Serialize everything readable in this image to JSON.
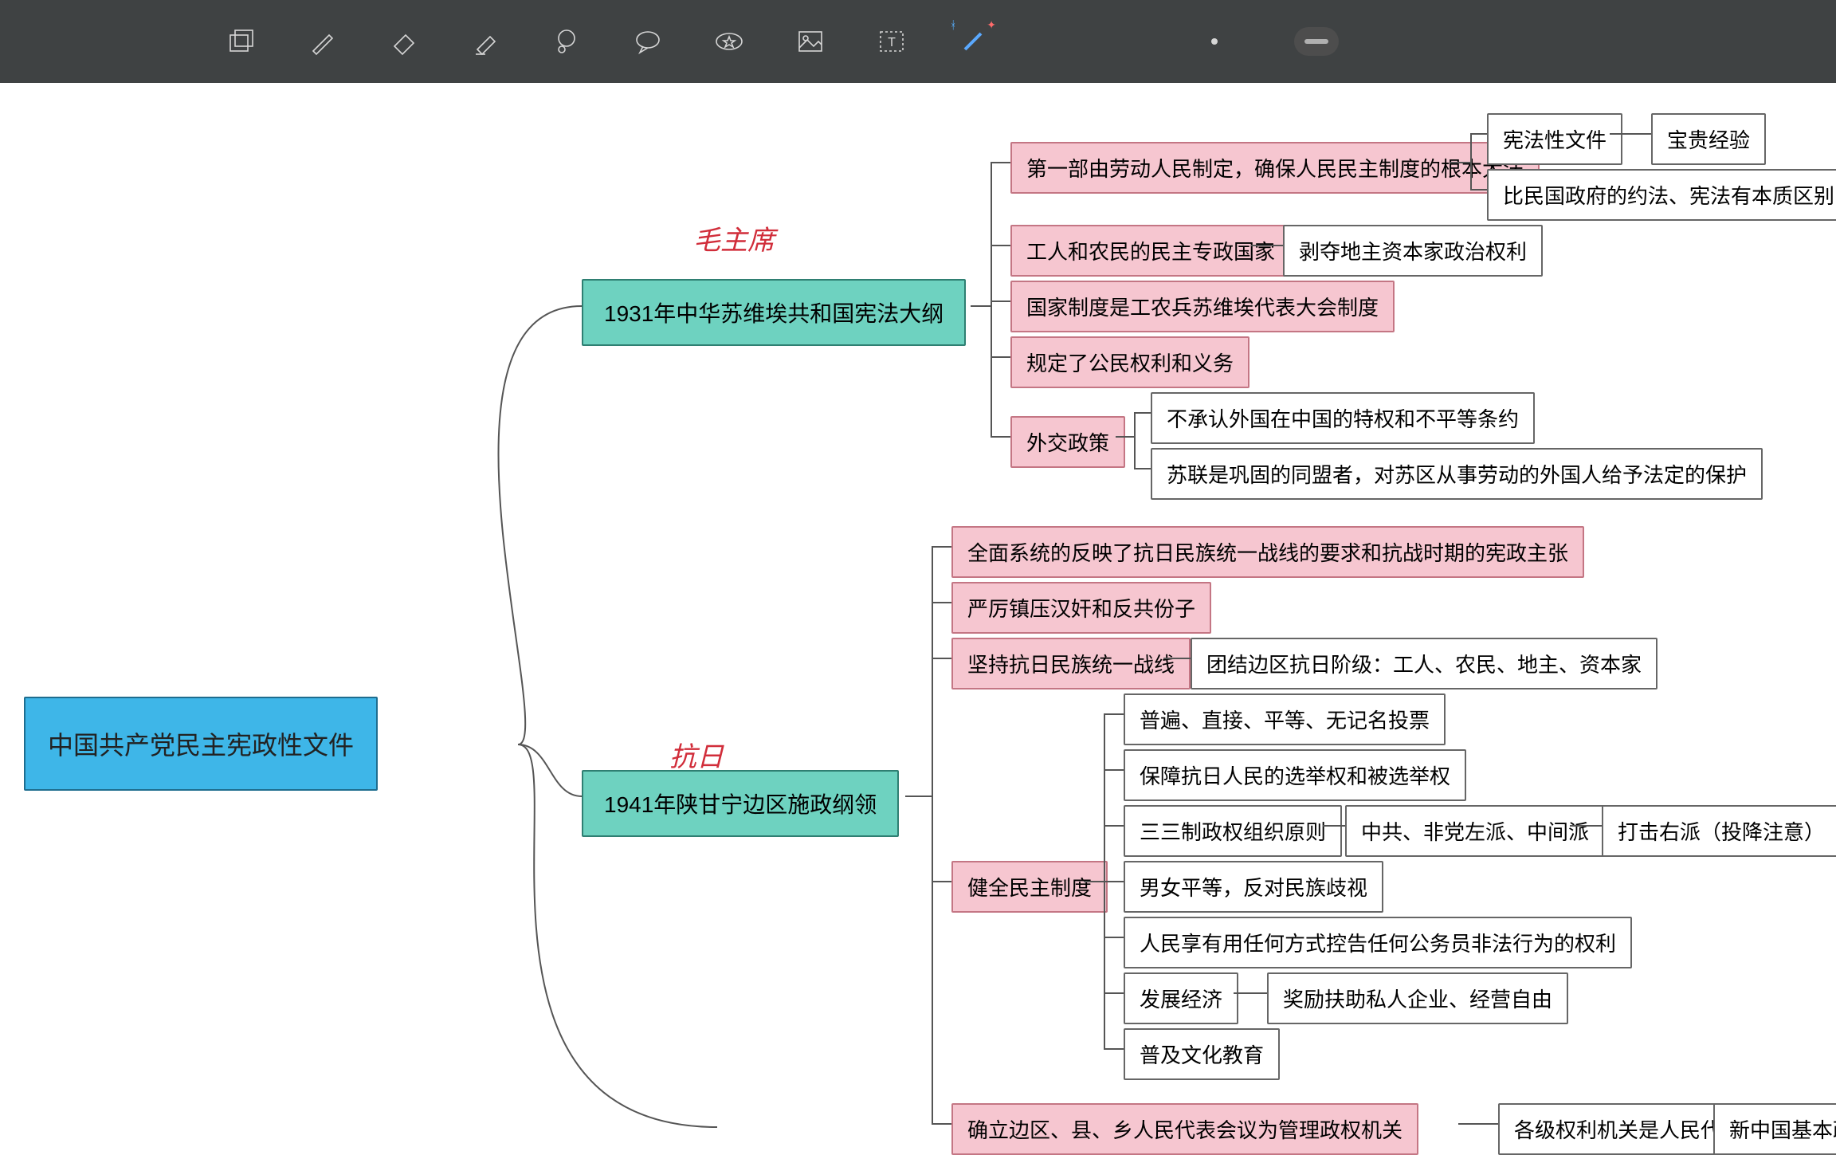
{
  "toolbar": {
    "icons": [
      "layers",
      "pen",
      "eraser",
      "highlighter",
      "lasso-circle",
      "speech-bubble",
      "star-badge",
      "image",
      "text",
      "magic-wand"
    ]
  },
  "annotations": {
    "hand1": "毛主席",
    "hand2": "抗日"
  },
  "mindmap": {
    "root": "中国共产党民主宪政性文件",
    "branch1": {
      "title": "1931年中华苏维埃共和国宪法大纲",
      "children": {
        "c1": "第一部由劳动人民制定，确保人民民主制度的根本大法",
        "c1a": "宪法性文件",
        "c1b": "宝贵经验",
        "c1c": "比民国政府的约法、宪法有本质区别",
        "c2": "工人和农民的民主专政国家",
        "c2a": "剥夺地主资本家政治权利",
        "c3": "国家制度是工农兵苏维埃代表大会制度",
        "c4": "规定了公民权利和义务",
        "c5": "外交政策",
        "c5a": "不承认外国在中国的特权和不平等条约",
        "c5b": "苏联是巩固的同盟者，对苏区从事劳动的外国人给予法定的保护"
      }
    },
    "branch2": {
      "title": "1941年陕甘宁边区施政纲领",
      "children": {
        "d1": "全面系统的反映了抗日民族统一战线的要求和抗战时期的宪政主张",
        "d2": "严厉镇压汉奸和反共份子",
        "d3": "坚持抗日民族统一战线",
        "d3a": "团结边区抗日阶级：工人、农民、地主、资本家",
        "d4": "健全民主制度",
        "d4a": "普遍、直接、平等、无记名投票",
        "d4b": "保障抗日人民的选举权和被选举权",
        "d4c": "三三制政权组织原则",
        "d4c1": "中共、非党左派、中间派",
        "d4c2": "打击右派（投降注意）",
        "d4d": "男女平等，反对民族歧视",
        "d4e": "人民享有用任何方式控告任何公务员非法行为的权利",
        "d4f": "发展经济",
        "d4f1": "奖励扶助私人企业、经营自由",
        "d4g": "普及文化教育",
        "d5": "确立边区、县、乡人民代表会议为管理政权机关",
        "d5a": "各级权利机关是人民代表会议制度",
        "d5b": "新中国基本政治"
      }
    }
  }
}
